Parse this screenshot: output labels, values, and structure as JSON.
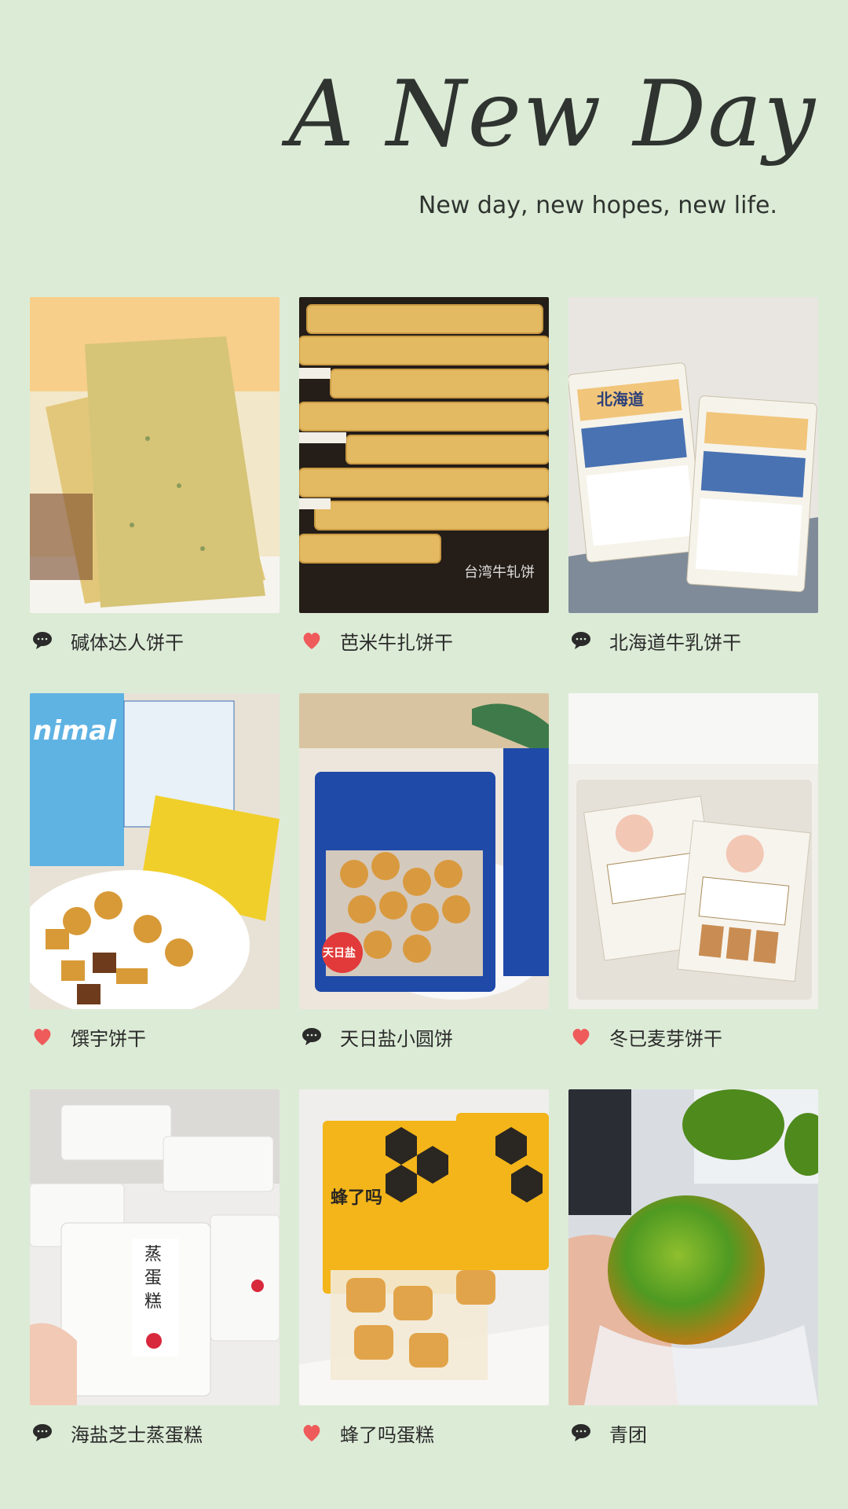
{
  "header": {
    "title": "A New Day",
    "subtitle": "New day, new hopes, new life."
  },
  "items": [
    {
      "label": "碱体达人饼干",
      "icon": "comment-icon",
      "thumb_label": ""
    },
    {
      "label": "芭米牛扎饼干",
      "icon": "heart-icon",
      "thumb_label": "台湾牛轧饼"
    },
    {
      "label": "北海道牛乳饼干",
      "icon": "comment-icon",
      "thumb_label": "北海道"
    },
    {
      "label": "馔宇饼干",
      "icon": "heart-icon",
      "thumb_label": "nimal"
    },
    {
      "label": "天日盐小圆饼",
      "icon": "comment-icon",
      "thumb_label": "天日盐"
    },
    {
      "label": "冬已麦芽饼干",
      "icon": "heart-icon",
      "thumb_label": ""
    },
    {
      "label": "海盐芝士蒸蛋糕",
      "icon": "comment-icon",
      "thumb_label": "蒸蛋糕"
    },
    {
      "label": "蜂了吗蛋糕",
      "icon": "heart-icon",
      "thumb_label": "蜂了吗"
    },
    {
      "label": "青团",
      "icon": "comment-icon",
      "thumb_label": ""
    }
  ],
  "colors": {
    "background": "#dcebd6",
    "heart": "#ef5a5a",
    "comment": "#2a2a2a",
    "text": "#2a2a2a"
  }
}
